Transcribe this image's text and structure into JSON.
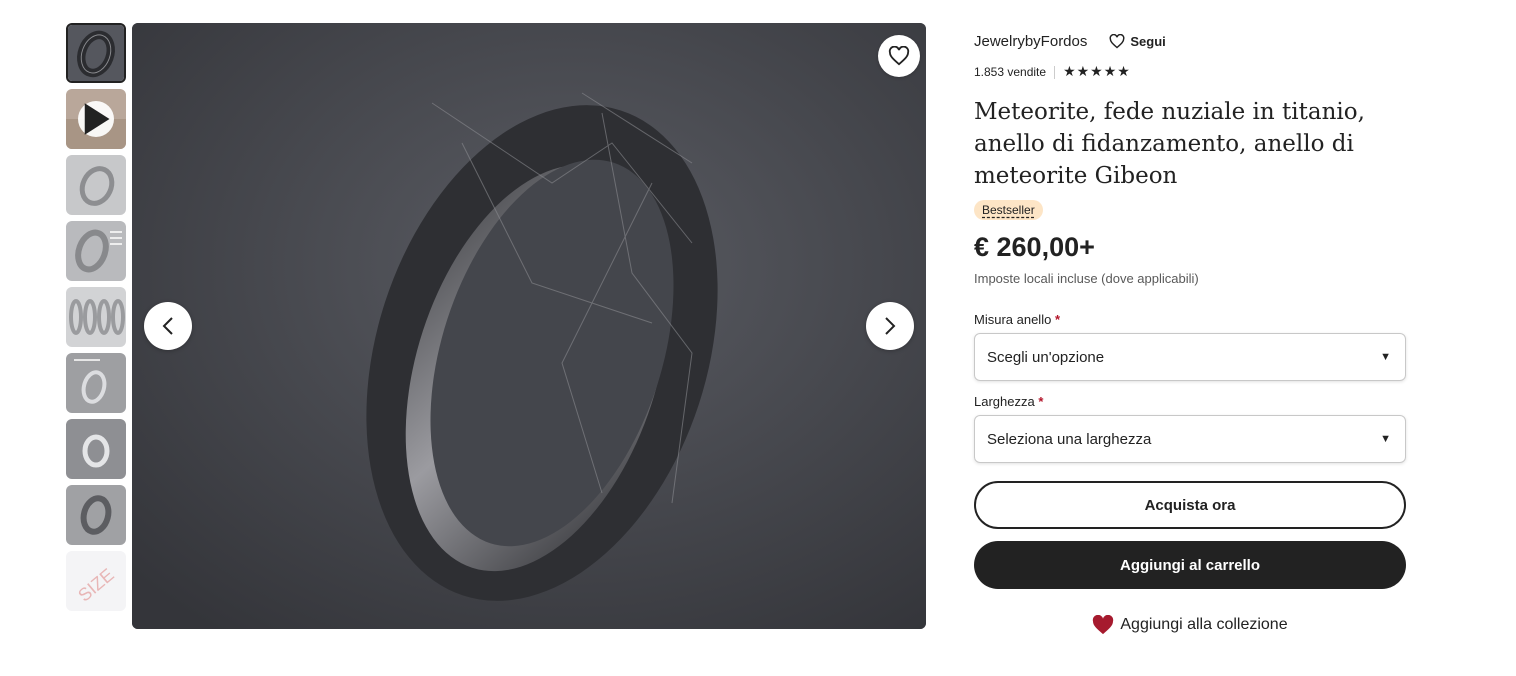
{
  "gallery": {
    "thumbnails": [
      {
        "name": "thumb-ring-meteorite",
        "kind": "image"
      },
      {
        "name": "thumb-video",
        "kind": "video"
      },
      {
        "name": "thumb-ring-silver",
        "kind": "image"
      },
      {
        "name": "thumb-ring-text",
        "kind": "image"
      },
      {
        "name": "thumb-rings-row",
        "kind": "image"
      },
      {
        "name": "thumb-ring-box",
        "kind": "image"
      },
      {
        "name": "thumb-ring-side",
        "kind": "image"
      },
      {
        "name": "thumb-ring-angle",
        "kind": "image"
      },
      {
        "name": "thumb-size-chart",
        "kind": "image"
      }
    ],
    "size_thumb_text": "SIZE",
    "icons": {
      "favorite": "heart-outline-icon",
      "prev": "chevron-left-icon",
      "next": "chevron-right-icon",
      "play": "play-icon"
    }
  },
  "shop": {
    "name": "JewelrybyFordos",
    "follow_label": "Segui",
    "sales": "1.853 vendite",
    "stars": "★★★★★",
    "rating": 5
  },
  "product": {
    "title": "Meteorite, fede nuziale in titanio, anello di fidanzamento, anello di meteorite Gibeon",
    "badge": "Bestseller",
    "price": "€ 260,00+",
    "tax_note": "Imposte locali incluse (dove applicabili)"
  },
  "options": {
    "ring_size_label": "Misura anello",
    "ring_size_placeholder": "Scegli un'opzione",
    "width_label": "Larghezza",
    "width_placeholder": "Seleziona una larghezza",
    "required_mark": "*"
  },
  "actions": {
    "buy_now": "Acquista ora",
    "add_to_cart": "Aggiungi al carrello",
    "add_to_collection": "Aggiungi alla collezione"
  },
  "colors": {
    "text": "#222222",
    "badge_bg": "#fde5c6",
    "required": "#b3152a",
    "collection_heart": "#a61a2e",
    "dark_button": "#222222"
  }
}
